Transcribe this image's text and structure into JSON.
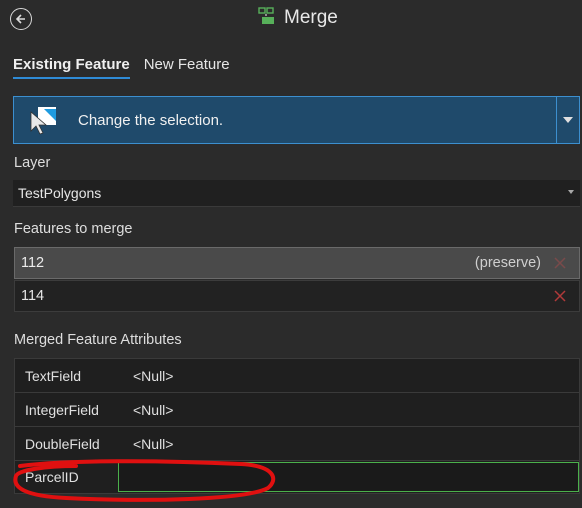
{
  "header": {
    "title": "Merge",
    "back_icon": "back-arrow-icon",
    "title_icon": "merge-icon"
  },
  "tabs": [
    {
      "label": "Existing Feature",
      "active": true
    },
    {
      "label": "New Feature",
      "active": false
    }
  ],
  "banner": {
    "text": "Change the selection.",
    "icon": "select-arrow-icon"
  },
  "layer": {
    "label": "Layer",
    "value": "TestPolygons"
  },
  "features": {
    "label": "Features to merge",
    "items": [
      {
        "id": "112",
        "tag": "(preserve)",
        "selected": true
      },
      {
        "id": "114",
        "tag": "",
        "selected": false
      }
    ]
  },
  "attributes": {
    "label": "Merged Feature Attributes",
    "rows": [
      {
        "name": "TextField",
        "value": "<Null>"
      },
      {
        "name": "IntegerField",
        "value": "<Null>"
      },
      {
        "name": "DoubleField",
        "value": "<Null>"
      },
      {
        "name": "ParcelID",
        "value": ""
      }
    ]
  },
  "colors": {
    "accent": "#2f8bd6",
    "banner_bg": "#1f4a6b",
    "active_field": "#4bb04b",
    "remove": "#c0392b",
    "annotation": "#e01010"
  }
}
